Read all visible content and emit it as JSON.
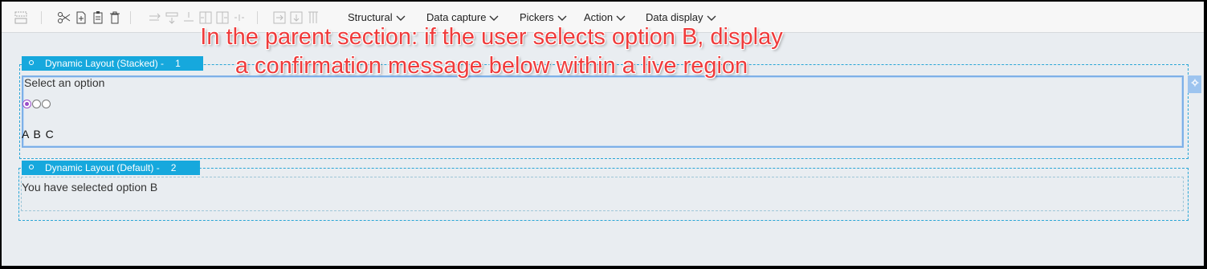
{
  "toolbar": {
    "icons": [
      "layout-icon",
      "cut-icon",
      "add-page-icon",
      "clipboard-icon",
      "delete-icon",
      "move-right-icon",
      "move-row-icon",
      "insert-above-icon",
      "insert-column-left-icon",
      "insert-column-right-icon",
      "insert-divider-icon",
      "insert-row-icon",
      "insert-row-below-icon",
      "column-icon"
    ],
    "menus": [
      {
        "label": "Structural"
      },
      {
        "label": "Data capture"
      },
      {
        "label": "Pickers"
      },
      {
        "label": "Action"
      },
      {
        "label": "Data display"
      }
    ]
  },
  "annotation": {
    "line1": "In the parent section: if the user selects option B, display",
    "line2": "a confirmation message below within a live region",
    "color": "#ef3b3b"
  },
  "layouts": [
    {
      "label": "Dynamic Layout (Stacked) -",
      "number": "1"
    },
    {
      "label": "Dynamic Layout (Default) -",
      "number": "2"
    }
  ],
  "radio_group": {
    "label": "Select an option",
    "options": [
      "A",
      "B",
      "C"
    ],
    "selected_index": 0,
    "options_text": "A B C"
  },
  "confirmation": {
    "text": "You have selected option B"
  },
  "colors": {
    "accent": "#16a8dd",
    "selected_border": "#7db0e8",
    "radio_checked": "#9b4bc9",
    "canvas": "#e9edf1"
  }
}
